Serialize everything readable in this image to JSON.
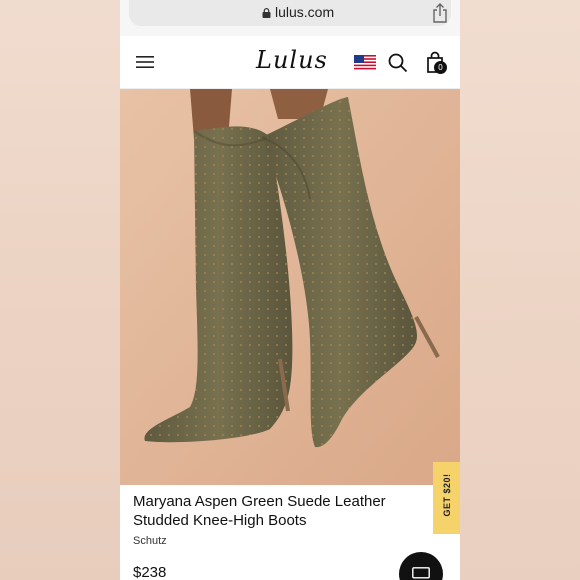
{
  "browser": {
    "url": "lulus.com"
  },
  "header": {
    "logo_text": "Lulus",
    "cart_count": "0"
  },
  "promo": {
    "tab_label": "GET $20!"
  },
  "product": {
    "title_line1": "Maryana Aspen Green Suede Leather",
    "title_line2": "Studded Knee-High Boots",
    "brand": "Schutz",
    "price": "$238"
  },
  "colors": {
    "promo_tab": "#f5d36a",
    "boot_suede": "#6f6a4e",
    "background": "#efd9cb"
  },
  "icons": [
    "lock-icon",
    "share-icon",
    "hamburger-icon",
    "us-flag-icon",
    "search-icon",
    "shopping-bag-icon",
    "chat-icon"
  ]
}
